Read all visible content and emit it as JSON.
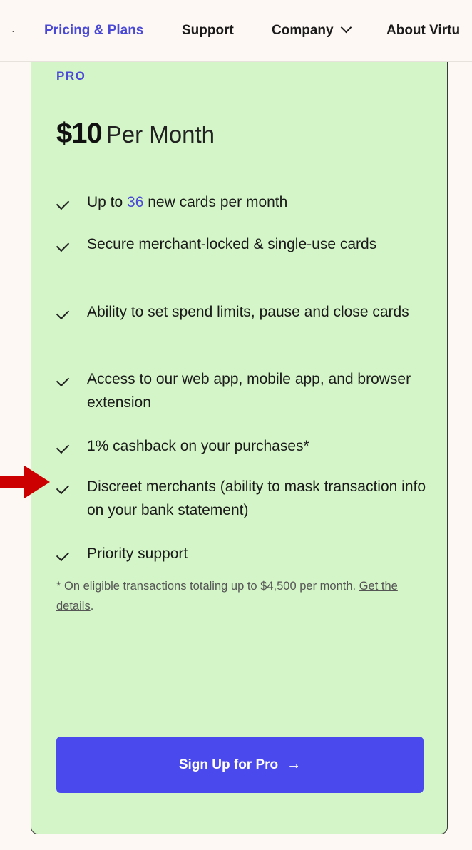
{
  "nav": {
    "items": [
      {
        "label": "Pricing & Plans"
      },
      {
        "label": "Support"
      },
      {
        "label": "Company"
      },
      {
        "label": "About Virtu"
      }
    ]
  },
  "plan": {
    "tier": "PRO",
    "price": "$10",
    "period": "Per Month",
    "features": [
      {
        "pre": "Up to ",
        "highlight": "36",
        "post": " new cards per month"
      },
      {
        "text": "Secure merchant-locked & single-use cards"
      },
      {
        "text": "Ability to set spend limits, pause and close cards"
      },
      {
        "text": "Access to our web app, mobile app, and browser extension"
      },
      {
        "text": "1% cashback on your purchases*"
      },
      {
        "text": "Discreet merchants (ability to mask transaction info on your bank statement)"
      },
      {
        "text": "Priority support"
      }
    ],
    "footnote_text": "* On eligible transactions totaling up to $4,500 per month. ",
    "footnote_link": "Get the details",
    "footnote_end": ".",
    "cta_label": "Sign Up for Pro",
    "cta_arrow": "→"
  },
  "colors": {
    "accent": "#4a49d6",
    "card_bg": "#d3f5c7",
    "cta_bg": "#4a49ee",
    "pointer": "#cc0000"
  },
  "icons": {
    "check": "check-icon",
    "chevron": "chevron-down-icon",
    "arrow": "arrow-right-icon"
  }
}
